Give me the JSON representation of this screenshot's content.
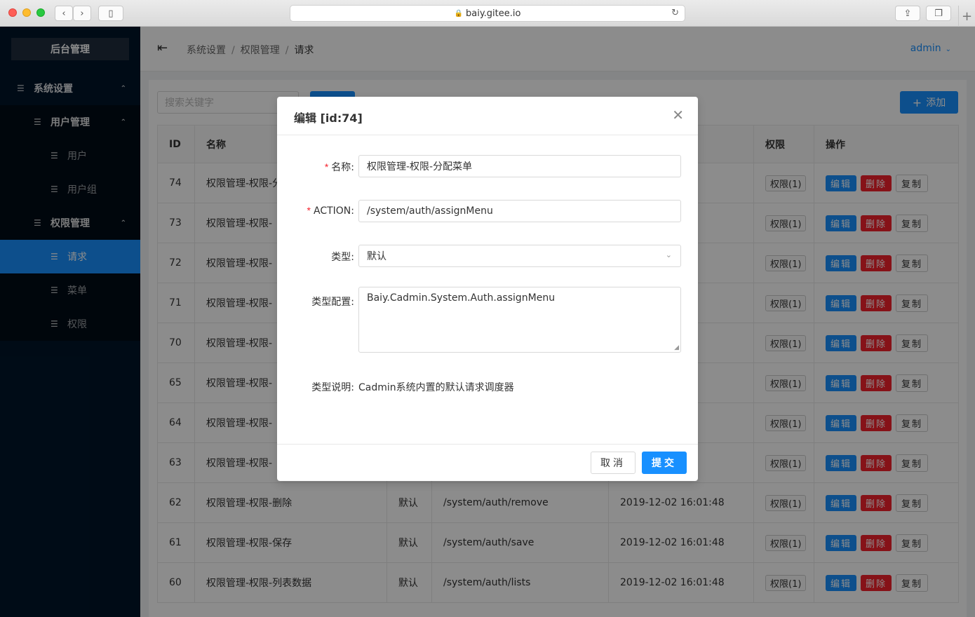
{
  "browser": {
    "url": "baiy.gitee.io"
  },
  "sidebar": {
    "logo": "后台管理",
    "items": [
      {
        "label": "系统设置",
        "level": 1
      },
      {
        "label": "用户管理",
        "level": 2
      },
      {
        "label": "用户",
        "level": 3
      },
      {
        "label": "用户组",
        "level": 3
      },
      {
        "label": "权限管理",
        "level": 2
      },
      {
        "label": "请求",
        "level": 3,
        "active": true
      },
      {
        "label": "菜单",
        "level": 3
      },
      {
        "label": "权限",
        "level": 3
      }
    ]
  },
  "header": {
    "breadcrumb": [
      "系统设置",
      "权限管理",
      "请求"
    ],
    "separator": "/",
    "user": "admin"
  },
  "toolbar": {
    "search_placeholder": "搜索关键字",
    "add_label": "添加"
  },
  "table": {
    "columns": [
      "ID",
      "名称",
      "",
      "",
      "",
      "权限",
      "操作"
    ],
    "rows": [
      {
        "id": "74",
        "name": "权限管理-权限-分配菜单",
        "type": "",
        "action": "",
        "time": "01:48",
        "perm": "权限(1)"
      },
      {
        "id": "73",
        "name": "权限管理-权限-",
        "type": "",
        "action": "",
        "time": "01:48",
        "perm": "权限(1)"
      },
      {
        "id": "72",
        "name": "权限管理-权限-",
        "type": "",
        "action": "",
        "time": "01:48",
        "perm": "权限(1)"
      },
      {
        "id": "71",
        "name": "权限管理-权限-",
        "type": "",
        "action": "",
        "time": "01:48",
        "perm": "权限(1)"
      },
      {
        "id": "70",
        "name": "权限管理-权限-",
        "type": "",
        "action": "",
        "time": "01:48",
        "perm": "权限(1)"
      },
      {
        "id": "65",
        "name": "权限管理-权限-",
        "type": "",
        "action": "",
        "time": "01:48",
        "perm": "权限(1)"
      },
      {
        "id": "64",
        "name": "权限管理-权限-",
        "type": "",
        "action": "",
        "time": "01:48",
        "perm": "权限(1)"
      },
      {
        "id": "63",
        "name": "权限管理-权限-",
        "type": "",
        "action": "",
        "time": "01:48",
        "perm": "权限(1)"
      },
      {
        "id": "62",
        "name": "权限管理-权限-删除",
        "type": "默认",
        "action": "/system/auth/remove",
        "time": "2019-12-02 16:01:48",
        "perm": "权限(1)"
      },
      {
        "id": "61",
        "name": "权限管理-权限-保存",
        "type": "默认",
        "action": "/system/auth/save",
        "time": "2019-12-02 16:01:48",
        "perm": "权限(1)"
      },
      {
        "id": "60",
        "name": "权限管理-权限-列表数据",
        "type": "默认",
        "action": "/system/auth/lists",
        "time": "2019-12-02 16:01:48",
        "perm": "权限(1)"
      }
    ],
    "row_buttons": {
      "edit": "编辑",
      "delete": "删除",
      "copy": "复制"
    }
  },
  "modal": {
    "title": "编辑 [id:74]",
    "fields": {
      "name_label": "名称:",
      "name_value": "权限管理-权限-分配菜单",
      "action_label": "ACTION:",
      "action_value": "/system/auth/assignMenu",
      "type_label": "类型:",
      "type_value": "默认",
      "config_label": "类型配置:",
      "config_value": "Baiy.Cadmin.System.Auth.assignMenu",
      "desc_label": "类型说明:",
      "desc_value": "Cadmin系统内置的默认请求调度器"
    },
    "cancel_label": "取消",
    "submit_label": "提交"
  },
  "colors": {
    "primary": "#1890ff",
    "danger": "#f5222d",
    "sidebar": "#001529"
  }
}
